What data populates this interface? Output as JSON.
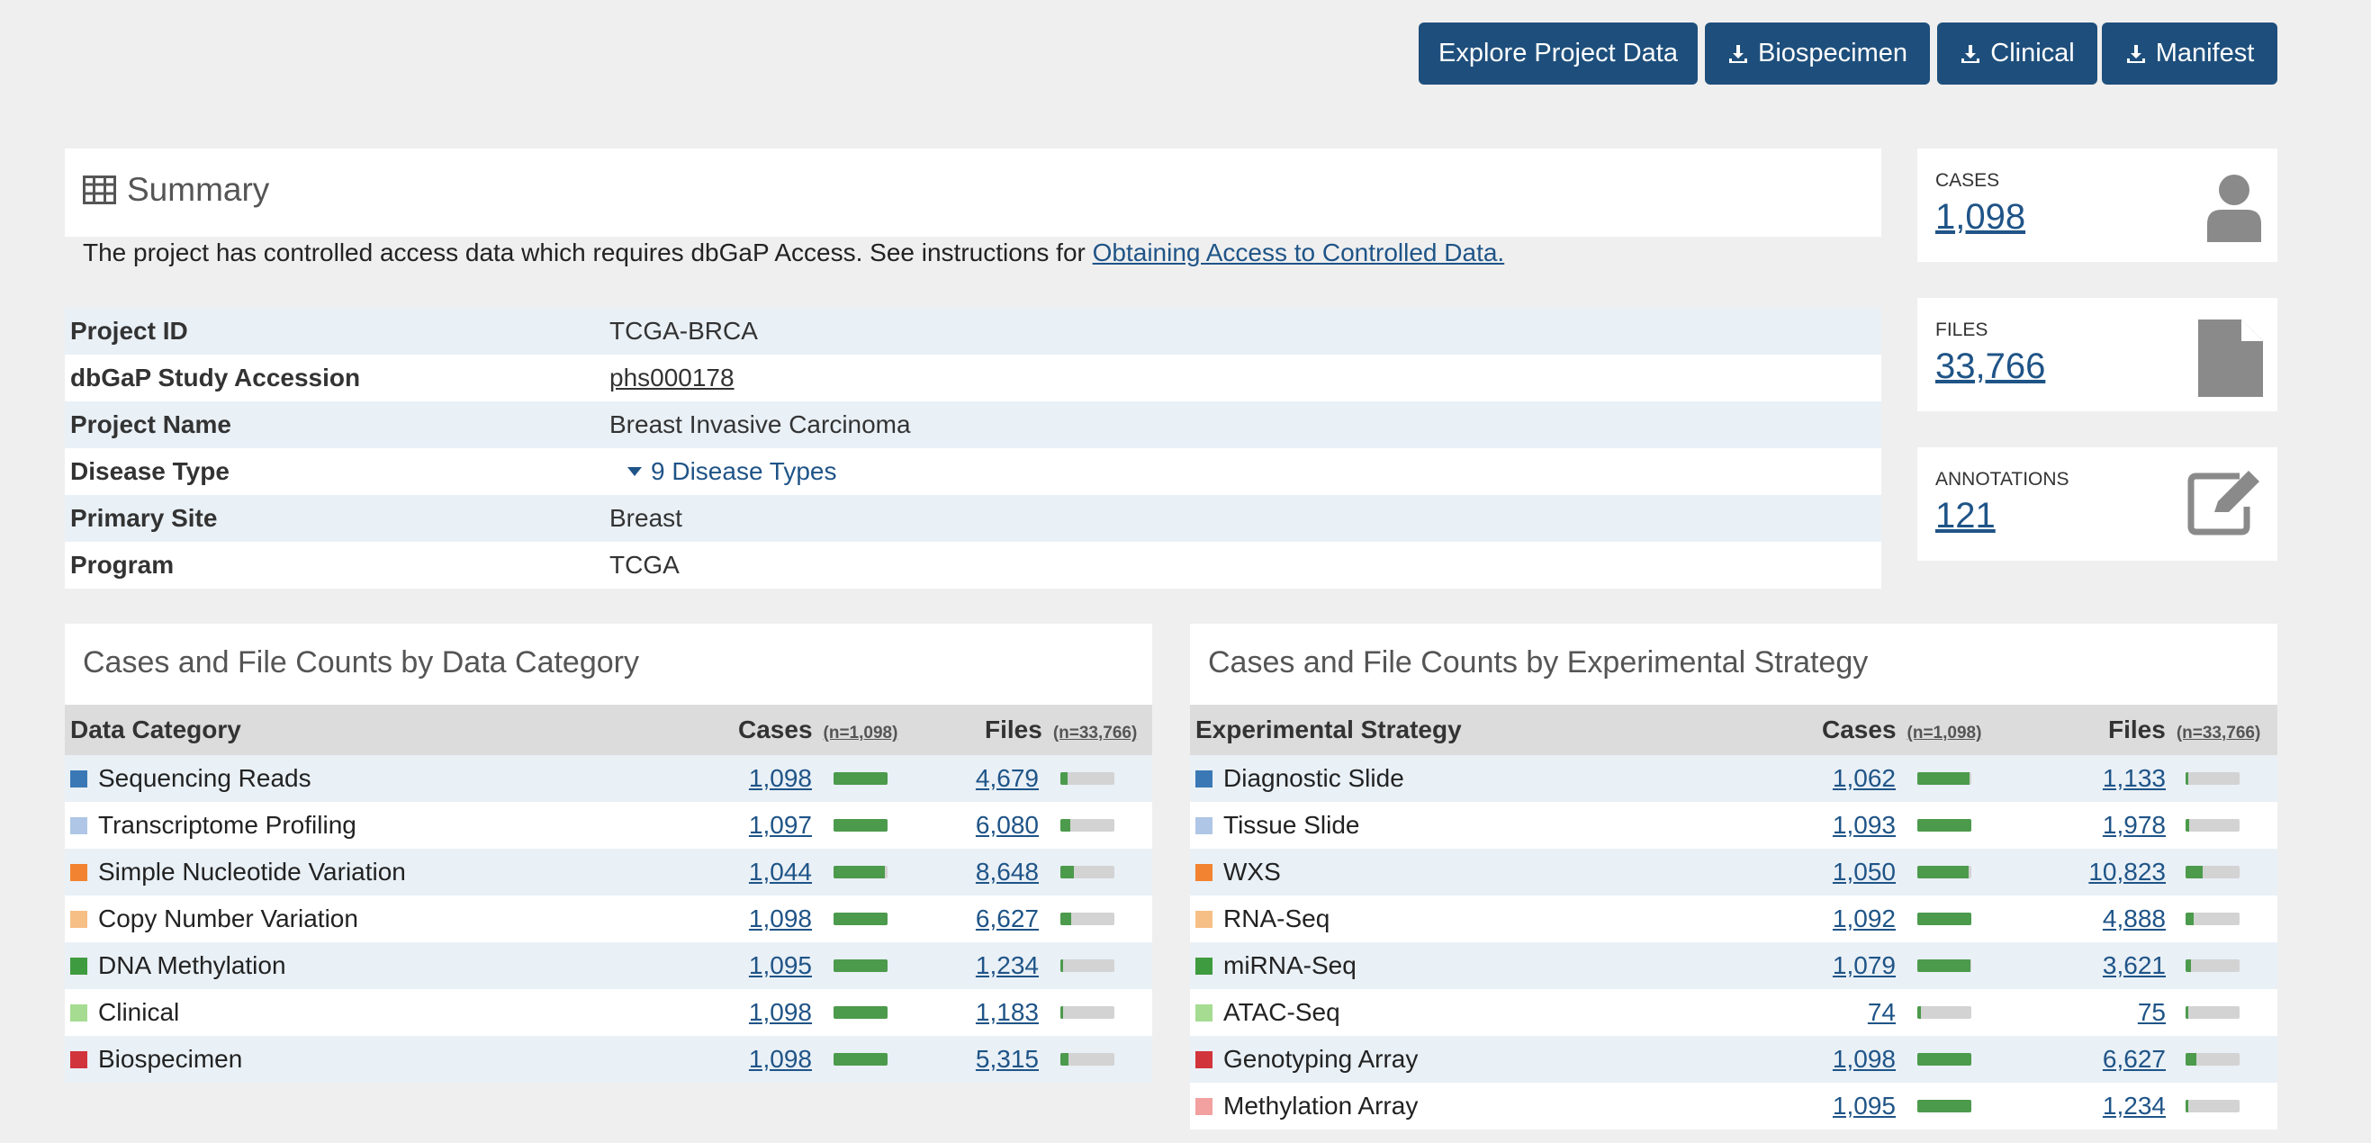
{
  "colors": {
    "brand": "#1e4f7c",
    "link": "#1f5487",
    "bar_fill": "#4c9a4c",
    "bar_track": "#d3d3d3",
    "row_alt": "#e9f0f6"
  },
  "toolbar": {
    "explore_label": "Explore Project Data",
    "biospecimen_label": "Biospecimen",
    "clinical_label": "Clinical",
    "manifest_label": "Manifest",
    "download_icon": "download-icon"
  },
  "summary": {
    "title": "Summary",
    "title_icon": "table-icon",
    "note_prefix": "The project has controlled access data which requires dbGaP Access. See instructions for ",
    "note_link": "Obtaining Access to Controlled Data.",
    "rows": [
      {
        "key": "Project ID",
        "value": "TCGA-BRCA"
      },
      {
        "key": "dbGaP Study Accession",
        "value": "phs000178"
      },
      {
        "key": "Project Name",
        "value": "Breast Invasive Carcinoma"
      },
      {
        "key": "Disease Type",
        "value": "9 Disease Types"
      },
      {
        "key": "Primary Site",
        "value": "Breast"
      },
      {
        "key": "Program",
        "value": "TCGA"
      }
    ]
  },
  "stats": {
    "cases": {
      "label": "CASES",
      "value": "1,098",
      "icon": "user-icon"
    },
    "files": {
      "label": "FILES",
      "value": "33,766",
      "icon": "file-icon"
    },
    "annotations": {
      "label": "ANNOTATIONS",
      "value": "121",
      "icon": "edit-icon"
    }
  },
  "data_category": {
    "title": "Cases and File Counts by Data Category",
    "col_name": "Data Category",
    "col_cases": "Cases",
    "cases_n": "(n=1,098)",
    "col_files": "Files",
    "files_n": "(n=33,766)",
    "rows": [
      {
        "name": "Sequencing Reads",
        "color": "#3a78b5",
        "cases": "1,098",
        "files": "4,679",
        "cases_frac": 1.0,
        "files_frac": 0.139
      },
      {
        "name": "Transcriptome Profiling",
        "color": "#afc6e6",
        "cases": "1,097",
        "files": "6,080",
        "cases_frac": 0.999,
        "files_frac": 0.18
      },
      {
        "name": "Simple Nucleotide Variation",
        "color": "#f28330",
        "cases": "1,044",
        "files": "8,648",
        "cases_frac": 0.951,
        "files_frac": 0.256
      },
      {
        "name": "Copy Number Variation",
        "color": "#f6bf86",
        "cases": "1,098",
        "files": "6,627",
        "cases_frac": 1.0,
        "files_frac": 0.196
      },
      {
        "name": "DNA Methylation",
        "color": "#3f9b3f",
        "cases": "1,095",
        "files": "1,234",
        "cases_frac": 0.997,
        "files_frac": 0.037
      },
      {
        "name": "Clinical",
        "color": "#a5dc91",
        "cases": "1,098",
        "files": "1,183",
        "cases_frac": 1.0,
        "files_frac": 0.035
      },
      {
        "name": "Biospecimen",
        "color": "#d1343a",
        "cases": "1,098",
        "files": "5,315",
        "cases_frac": 1.0,
        "files_frac": 0.157
      }
    ]
  },
  "experimental_strategy": {
    "title": "Cases and File Counts by Experimental Strategy",
    "col_name": "Experimental Strategy",
    "col_cases": "Cases",
    "cases_n": "(n=1,098)",
    "col_files": "Files",
    "files_n": "(n=33,766)",
    "rows": [
      {
        "name": "Diagnostic Slide",
        "color": "#3a78b5",
        "cases": "1,062",
        "files": "1,133",
        "cases_frac": 0.967,
        "files_frac": 0.034
      },
      {
        "name": "Tissue Slide",
        "color": "#afc6e6",
        "cases": "1,093",
        "files": "1,978",
        "cases_frac": 0.995,
        "files_frac": 0.059
      },
      {
        "name": "WXS",
        "color": "#f28330",
        "cases": "1,050",
        "files": "10,823",
        "cases_frac": 0.956,
        "files_frac": 0.321
      },
      {
        "name": "RNA-Seq",
        "color": "#f6bf86",
        "cases": "1,092",
        "files": "4,888",
        "cases_frac": 0.995,
        "files_frac": 0.145
      },
      {
        "name": "miRNA-Seq",
        "color": "#3f9b3f",
        "cases": "1,079",
        "files": "3,621",
        "cases_frac": 0.983,
        "files_frac": 0.107
      },
      {
        "name": "ATAC-Seq",
        "color": "#a5dc91",
        "cases": "74",
        "files": "75",
        "cases_frac": 0.067,
        "files_frac": 0.002
      },
      {
        "name": "Genotyping Array",
        "color": "#d1343a",
        "cases": "1,098",
        "files": "6,627",
        "cases_frac": 1.0,
        "files_frac": 0.196
      },
      {
        "name": "Methylation Array",
        "color": "#f2a0a0",
        "cases": "1,095",
        "files": "1,234",
        "cases_frac": 0.997,
        "files_frac": 0.037
      }
    ]
  }
}
